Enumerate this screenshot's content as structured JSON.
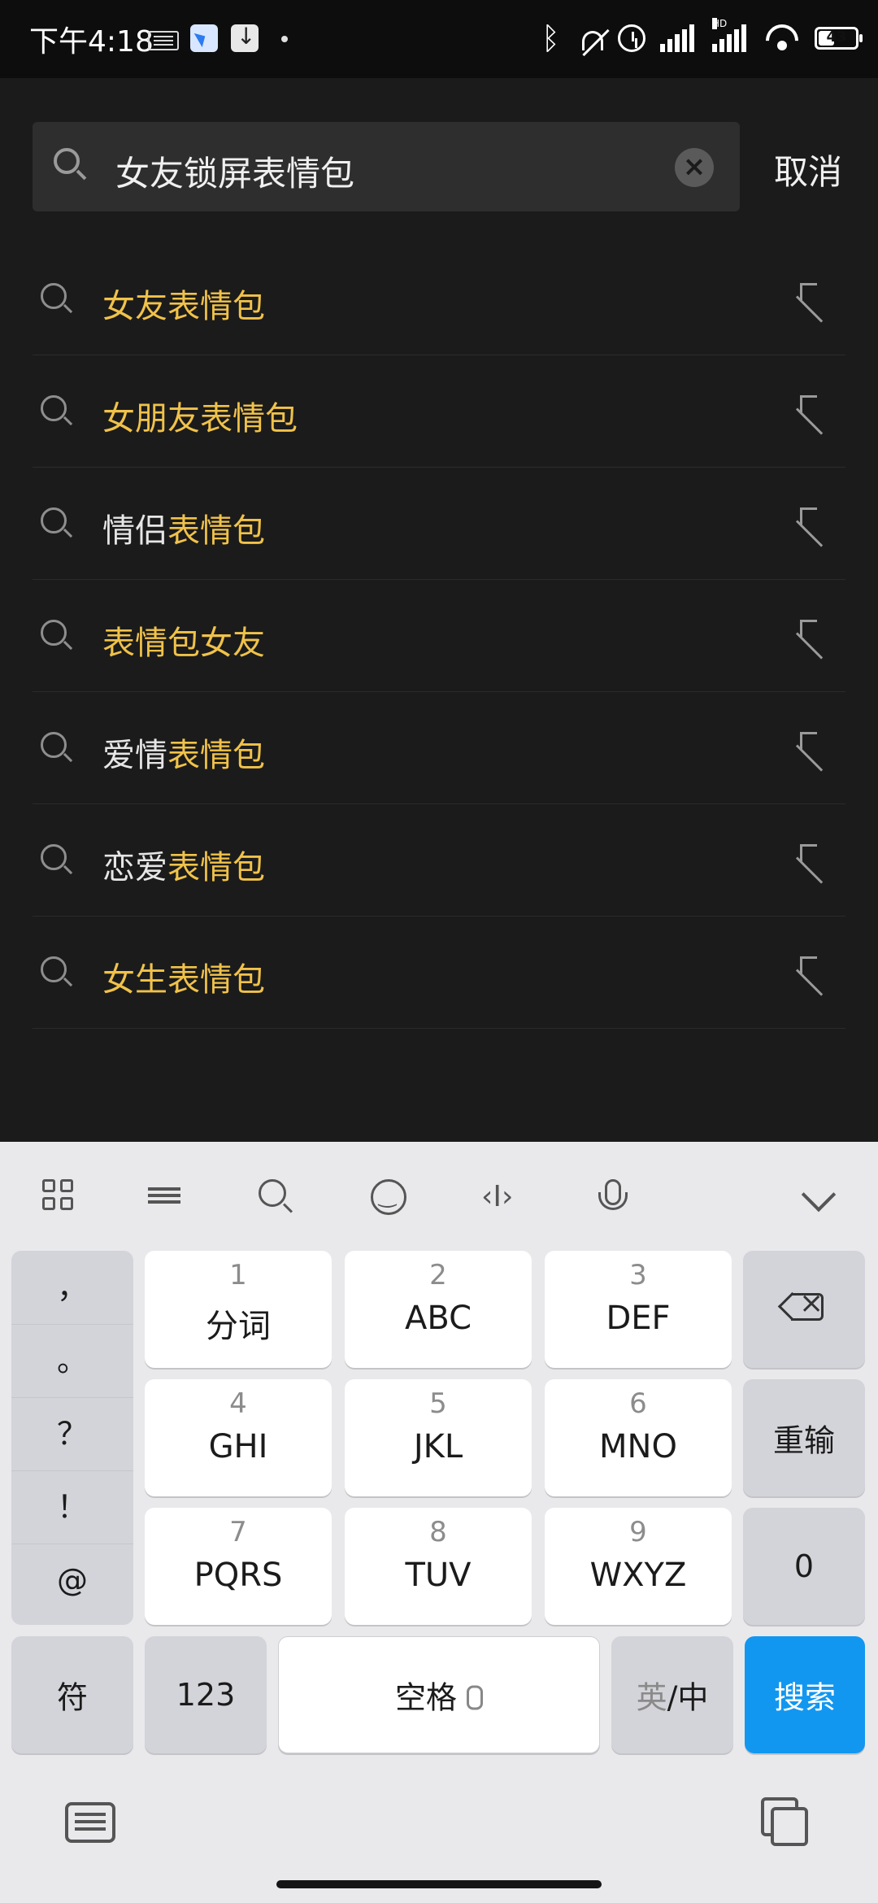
{
  "status_bar": {
    "time": "下午4:18",
    "battery_level": "43",
    "battery_fraction": 0.43,
    "icons": [
      "keyboard-icon",
      "app-notification-icon",
      "download-icon",
      "bluetooth-icon",
      "mute-icon",
      "alarm-icon",
      "signal-icon",
      "hd-signal-icon",
      "wifi-icon",
      "battery-icon"
    ]
  },
  "search": {
    "query": "女友锁屏表情包",
    "cancel_label": "取消"
  },
  "suggestions": [
    {
      "parts": [
        {
          "t": "女友表情包",
          "h": true
        }
      ]
    },
    {
      "parts": [
        {
          "t": "女朋友表情包",
          "h": true
        }
      ]
    },
    {
      "parts": [
        {
          "t": "情侣",
          "h": false
        },
        {
          "t": "表情包",
          "h": true
        }
      ]
    },
    {
      "parts": [
        {
          "t": "表情包女友",
          "h": true
        }
      ]
    },
    {
      "parts": [
        {
          "t": "爱情",
          "h": false
        },
        {
          "t": "表情包",
          "h": true
        }
      ]
    },
    {
      "parts": [
        {
          "t": "恋爱",
          "h": false
        },
        {
          "t": "表情包",
          "h": true
        }
      ]
    },
    {
      "parts": [
        {
          "t": "女生",
          "h": true
        },
        {
          "t": "表情包",
          "h": true
        }
      ]
    }
  ],
  "keyboard": {
    "punctuation": [
      "，",
      "。",
      "？",
      "！",
      "@"
    ],
    "keys": [
      {
        "num": "1",
        "label": "分词"
      },
      {
        "num": "2",
        "label": "ABC"
      },
      {
        "num": "3",
        "label": "DEF"
      },
      {
        "num": "4",
        "label": "GHI"
      },
      {
        "num": "5",
        "label": "JKL"
      },
      {
        "num": "6",
        "label": "MNO"
      },
      {
        "num": "7",
        "label": "PQRS"
      },
      {
        "num": "8",
        "label": "TUV"
      },
      {
        "num": "9",
        "label": "WXYZ"
      }
    ],
    "reinput_label": "重输",
    "zero_label": "0",
    "symbol_label": "符",
    "numeric_label": "123",
    "space_label": "空格",
    "lang_en": "英",
    "lang_sep": "/",
    "lang_zh": "中",
    "search_label": "搜索",
    "accent_color": "#1297f0",
    "highlight_color": "#f0c24a"
  }
}
